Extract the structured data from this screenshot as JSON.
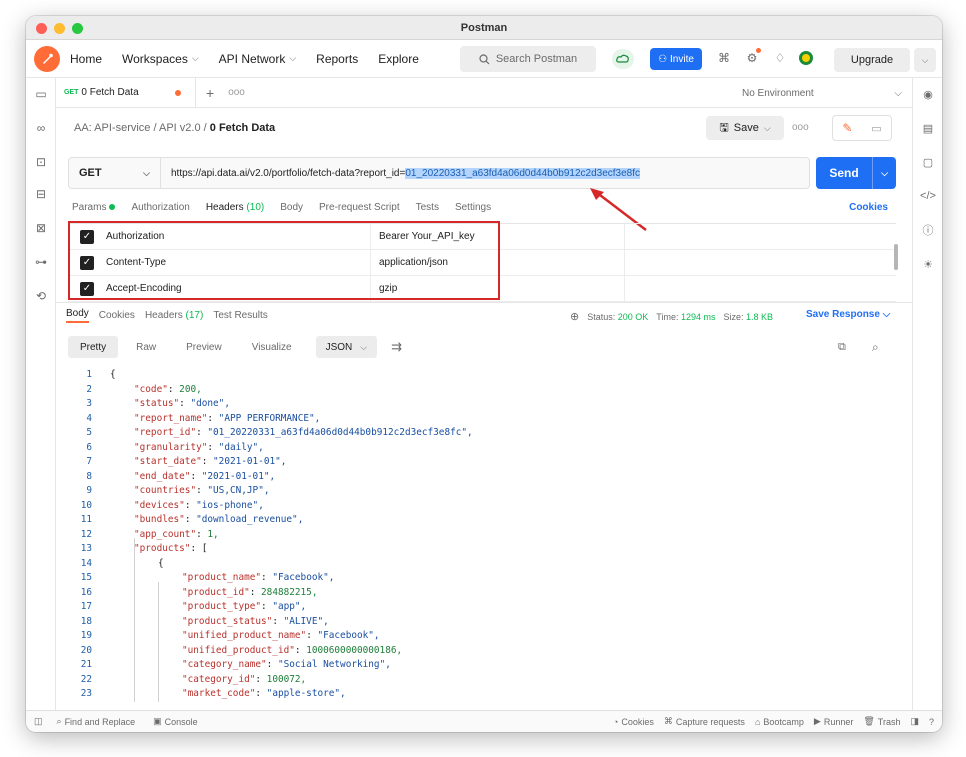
{
  "window": {
    "title": "Postman"
  },
  "nav": {
    "home": "Home",
    "workspaces": "Workspaces",
    "api_network": "API Network",
    "reports": "Reports",
    "explore": "Explore",
    "search_placeholder": "Search Postman",
    "invite": "Invite",
    "upgrade": "Upgrade"
  },
  "tab": {
    "method": "GET",
    "label": "0 Fetch Data"
  },
  "tabbar": {
    "more": "ooo",
    "environment": "No Environment"
  },
  "breadcrumb": {
    "part1": "AA: API-service",
    "sep": "/",
    "part2": "API v2.0",
    "current": "0 Fetch Data"
  },
  "save": {
    "label": "Save",
    "more": "ooo"
  },
  "request": {
    "method": "GET",
    "url_prefix": "https://api.data.ai/v2.0/portfolio/fetch-data?report_id=",
    "url_selected": "01_20220331_a63fd4a06d0d44b0b912c2d3ecf3e8fc",
    "send": "Send"
  },
  "request_tabs": {
    "params": "Params",
    "authorization": "Authorization",
    "headers": "Headers",
    "headers_count": "(10)",
    "body": "Body",
    "prerequest": "Pre-request Script",
    "tests": "Tests",
    "settings": "Settings",
    "cookies": "Cookies"
  },
  "headers": [
    {
      "key": "Authorization",
      "value": "Bearer Your_API_key"
    },
    {
      "key": "Content-Type",
      "value": "application/json"
    },
    {
      "key": "Accept-Encoding",
      "value": "gzip"
    }
  ],
  "response_tabs": {
    "body": "Body",
    "cookies": "Cookies",
    "headers": "Headers",
    "headers_count": "(17)",
    "test_results": "Test Results"
  },
  "status": {
    "status_label": "Status:",
    "status_value": "200 OK",
    "time_label": "Time:",
    "time_value": "1294 ms",
    "size_label": "Size:",
    "size_value": "1.8 KB",
    "save_response": "Save Response"
  },
  "view": {
    "pretty": "Pretty",
    "raw": "Raw",
    "preview": "Preview",
    "visualize": "Visualize",
    "format": "JSON"
  },
  "code_lines": [
    {
      "n": "1",
      "k": "",
      "v": "{",
      "t": "pun",
      "i": 0
    },
    {
      "n": "2",
      "k": "\"code\"",
      "v": "200,",
      "t": "num",
      "i": 1
    },
    {
      "n": "3",
      "k": "\"status\"",
      "v": "\"done\",",
      "t": "str",
      "i": 1
    },
    {
      "n": "4",
      "k": "\"report_name\"",
      "v": "\"APP PERFORMANCE\",",
      "t": "str",
      "i": 1
    },
    {
      "n": "5",
      "k": "\"report_id\"",
      "v": "\"01_20220331_a63fd4a06d0d44b0b912c2d3ecf3e8fc\",",
      "t": "str",
      "i": 1
    },
    {
      "n": "6",
      "k": "\"granularity\"",
      "v": "\"daily\",",
      "t": "str",
      "i": 1
    },
    {
      "n": "7",
      "k": "\"start_date\"",
      "v": "\"2021-01-01\",",
      "t": "str",
      "i": 1
    },
    {
      "n": "8",
      "k": "\"end_date\"",
      "v": "\"2021-01-01\",",
      "t": "str",
      "i": 1
    },
    {
      "n": "9",
      "k": "\"countries\"",
      "v": "\"US,CN,JP\",",
      "t": "str",
      "i": 1
    },
    {
      "n": "10",
      "k": "\"devices\"",
      "v": "\"ios-phone\",",
      "t": "str",
      "i": 1
    },
    {
      "n": "11",
      "k": "\"bundles\"",
      "v": "\"download_revenue\",",
      "t": "str",
      "i": 1
    },
    {
      "n": "12",
      "k": "\"app_count\"",
      "v": "1,",
      "t": "num",
      "i": 1
    },
    {
      "n": "13",
      "k": "\"products\"",
      "v": "[",
      "t": "pun",
      "i": 1
    },
    {
      "n": "14",
      "k": "",
      "v": "{",
      "t": "pun",
      "i": 2
    },
    {
      "n": "15",
      "k": "\"product_name\"",
      "v": "\"Facebook\",",
      "t": "str",
      "i": 3
    },
    {
      "n": "16",
      "k": "\"product_id\"",
      "v": "284882215,",
      "t": "num",
      "i": 3
    },
    {
      "n": "17",
      "k": "\"product_type\"",
      "v": "\"app\",",
      "t": "str",
      "i": 3
    },
    {
      "n": "18",
      "k": "\"product_status\"",
      "v": "\"ALIVE\",",
      "t": "str",
      "i": 3
    },
    {
      "n": "19",
      "k": "\"unified_product_name\"",
      "v": "\"Facebook\",",
      "t": "str",
      "i": 3
    },
    {
      "n": "20",
      "k": "\"unified_product_id\"",
      "v": "1000600000000186,",
      "t": "num",
      "i": 3
    },
    {
      "n": "21",
      "k": "\"category_name\"",
      "v": "\"Social Networking\",",
      "t": "str",
      "i": 3
    },
    {
      "n": "22",
      "k": "\"category_id\"",
      "v": "100072,",
      "t": "num",
      "i": 3
    },
    {
      "n": "23",
      "k": "\"market_code\"",
      "v": "\"apple-store\",",
      "t": "str",
      "i": 3
    }
  ],
  "footer": {
    "find_replace": "Find and Replace",
    "console": "Console",
    "cookies": "Cookies",
    "capture": "Capture requests",
    "bootcamp": "Bootcamp",
    "runner": "Runner",
    "trash": "Trash"
  },
  "colors": {
    "accent": "#ff6c37",
    "primary": "#1f6ff5",
    "success": "#0cbb52",
    "highlight": "#d62828"
  }
}
